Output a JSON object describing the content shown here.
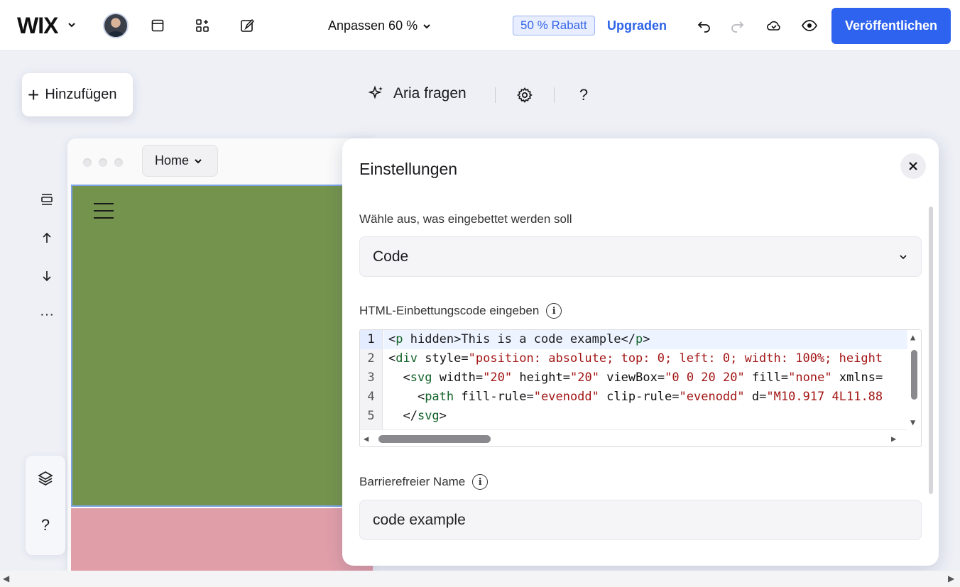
{
  "topbar": {
    "logo": "WIX",
    "zoom_label": "Anpassen 60 %",
    "discount_badge": "50 % Rabatt",
    "upgrade_link": "Upgraden",
    "publish_button": "Veröffentlichen"
  },
  "toolbar": {
    "add_button": "Hinzufügen",
    "aria_button": "Aria fragen",
    "help_glyph": "?"
  },
  "canvas": {
    "page_selector": "Home"
  },
  "left_rail": {
    "more_glyph": "···",
    "help_glyph": "?"
  },
  "panel": {
    "title": "Einstellungen",
    "embed_type_label": "Wähle aus, was eingebettet werden soll",
    "embed_type_value": "Code",
    "code_label": "HTML-Einbettungscode eingeben",
    "code_lines": [
      "<p hidden>This is a code example</p>",
      "<div style=\"position: absolute; top: 0; left: 0; width: 100%; height",
      "  <svg width=\"20\" height=\"20\" viewBox=\"0 0 20 20\" fill=\"none\" xmlns=",
      "    <path fill-rule=\"evenodd\" clip-rule=\"evenodd\" d=\"M10.917 4L11.88",
      "  </svg>"
    ],
    "line_numbers": [
      "1",
      "2",
      "3",
      "4",
      "5"
    ],
    "accessible_name_label": "Barrierefreier Name",
    "accessible_name_value": "code example"
  },
  "colors": {
    "accent": "#2e63f0",
    "green_section": "#74944d",
    "pink_section": "#e09ea9"
  }
}
